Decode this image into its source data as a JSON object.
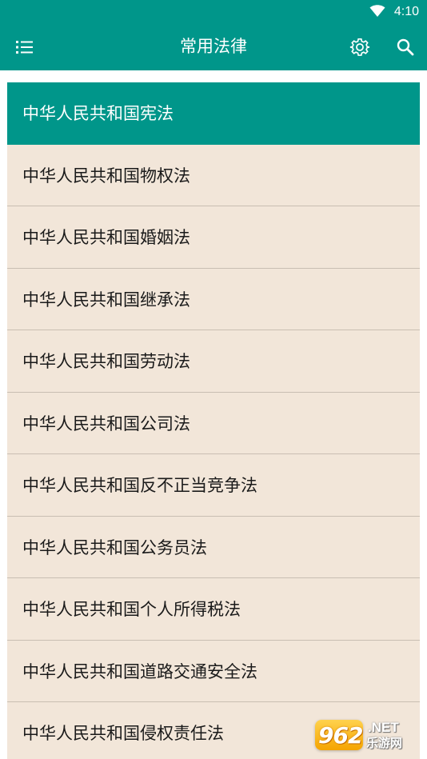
{
  "status_bar": {
    "time": "4:10",
    "wifi_icon": "wifi-icon"
  },
  "app_bar": {
    "title": "常用法律",
    "menu_icon": "menu-list-icon",
    "settings_icon": "gear-icon",
    "search_icon": "search-icon"
  },
  "colors": {
    "primary": "#00968a",
    "list_background": "#f2e6d9",
    "divider": "#c9beb2"
  },
  "laws": {
    "items": [
      {
        "label": "中华人民共和国宪法",
        "selected": true
      },
      {
        "label": "中华人民共和国物权法",
        "selected": false
      },
      {
        "label": "中华人民共和国婚姻法",
        "selected": false
      },
      {
        "label": "中华人民共和国继承法",
        "selected": false
      },
      {
        "label": "中华人民共和国劳动法",
        "selected": false
      },
      {
        "label": "中华人民共和国公司法",
        "selected": false
      },
      {
        "label": "中华人民共和国反不正当竞争法",
        "selected": false
      },
      {
        "label": "中华人民共和国公务员法",
        "selected": false
      },
      {
        "label": "中华人民共和国个人所得税法",
        "selected": false
      },
      {
        "label": "中华人民共和国道路交通安全法",
        "selected": false
      },
      {
        "label": "中华人民共和国侵权责任法",
        "selected": false
      }
    ]
  },
  "watermark": {
    "number": "962",
    "suffix": ".NET",
    "site_name": "乐游网"
  }
}
